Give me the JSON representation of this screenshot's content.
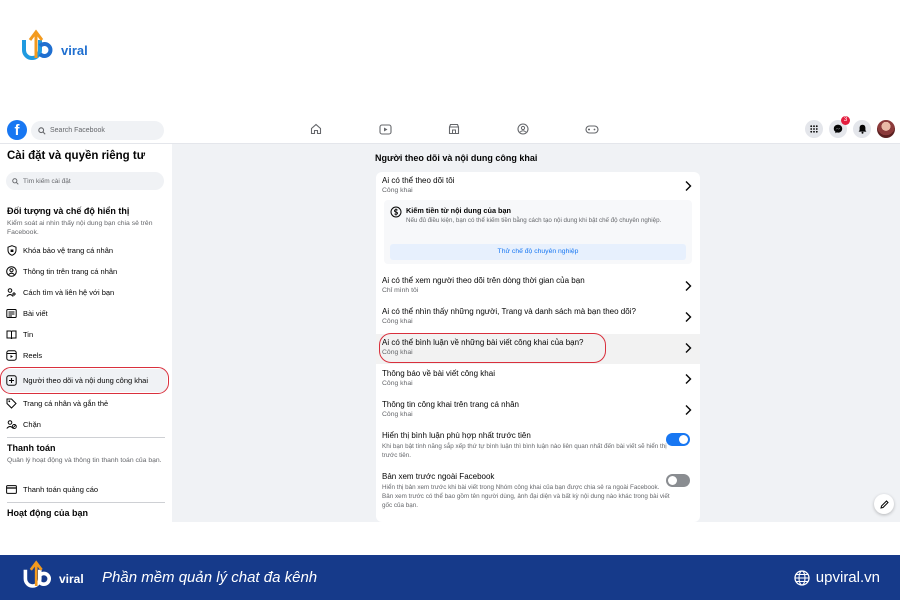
{
  "brand": {
    "suffix": "viral",
    "site": "upviral.vn",
    "tagline": "Phần mềm quản lý chat đa kênh"
  },
  "colors": {
    "facebook_blue": "#1877f2",
    "banner": "#163a8a",
    "highlight_red": "#d9303d"
  },
  "topnav": {
    "search_placeholder": "Search Facebook",
    "icons": [
      "home-icon",
      "video-icon",
      "marketplace-icon",
      "groups-icon",
      "gaming-icon"
    ],
    "notification_badge": "3"
  },
  "sidebar": {
    "title": "Cài đặt và quyền riêng tư",
    "search_placeholder": "Tìm kiếm cài đặt",
    "section1": {
      "title": "Đối tượng và chế độ hiển thị",
      "desc": "Kiểm soát ai nhìn thấy nội dung bạn chia sẻ trên Facebook."
    },
    "items": [
      {
        "label": "Khóa bảo vệ trang cá nhân",
        "icon": "shield-icon"
      },
      {
        "label": "Thông tin trên trang cá nhân",
        "icon": "profile-icon"
      },
      {
        "label": "Cách tìm và liên hệ với bạn",
        "icon": "people-icon"
      },
      {
        "label": "Bài viết",
        "icon": "posts-icon"
      },
      {
        "label": "Tin",
        "icon": "book-icon"
      },
      {
        "label": "Reels",
        "icon": "reels-icon"
      },
      {
        "label": "Người theo dõi và nội dung công khai",
        "icon": "followers-icon"
      },
      {
        "label": "Trang cá nhân và gắn thẻ",
        "icon": "tag-icon"
      },
      {
        "label": "Chặn",
        "icon": "block-icon"
      }
    ],
    "section2": {
      "title": "Thanh toán",
      "desc": "Quản lý hoạt động và thông tin thanh toán của bạn.",
      "item": "Thanh toán quảng cáo"
    },
    "section3": {
      "title": "Hoạt động của bạn"
    }
  },
  "main": {
    "title": "Người theo dõi và nội dung công khai",
    "rows": [
      {
        "title": "Ai có thể theo dõi tôi",
        "sub": "Công khai"
      },
      {
        "title": "Ai có thể xem người theo dõi trên dòng thời gian của bạn",
        "sub": "Chỉ mình tôi"
      },
      {
        "title": "Ai có thể nhìn thấy những người, Trang và danh sách mà bạn theo dõi?",
        "sub": "Công khai"
      },
      {
        "title": "Ai có thể bình luận về những bài viết công khai của bạn?",
        "sub": "Công khai"
      },
      {
        "title": "Thông báo về bài viết công khai",
        "sub": "Công khai"
      },
      {
        "title": "Thông tin công khai trên trang cá nhân",
        "sub": "Công khai"
      }
    ],
    "pro": {
      "title": "Kiếm tiền từ nội dung của bạn",
      "desc": "Nếu đủ điều kiện, bạn có thể kiếm tiền bằng cách tạo nội dung khi bật chế độ chuyên nghiệp.",
      "button": "Thử chế độ chuyên nghiệp"
    },
    "toggles": [
      {
        "title": "Hiển thị bình luận phù hợp nhất trước tiên",
        "desc": "Khi bạn bật tính năng sắp xếp thứ tự bình luận thì bình luận nào liên quan nhất đến bài viết sẽ hiển thị trước tiên.",
        "on": true
      },
      {
        "title": "Bản xem trước ngoài Facebook",
        "desc": "Hiển thị bản xem trước khi bài viết trong Nhóm công khai của bạn được chia sẻ ra ngoài Facebook. Bản xem trước có thể bao gồm tên người dùng, ảnh đại diện và bất kỳ nội dung nào khác trong bài viết gốc của bạn.",
        "on": false
      }
    ]
  }
}
